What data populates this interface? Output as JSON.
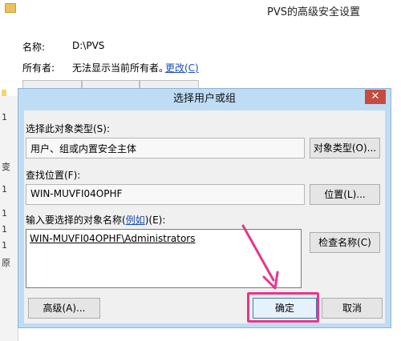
{
  "background_window": {
    "title": "PVS的高级安全设置",
    "name_label": "名称:",
    "name_value": "D:\\PVS",
    "owner_label": "所有者:",
    "owner_value": "无法显示当前所有者。",
    "change_link": "更改(C)",
    "left_strip_chars": [
      "1",
      "变",
      "1",
      "1",
      "1",
      "1",
      "原"
    ]
  },
  "dialog": {
    "title": "选择用户或组",
    "close_glyph": "✕",
    "object_type_label": "选择此对象类型(S):",
    "object_type_value": "用户、组或内置安全主体",
    "object_type_button": "对象类型(O)...",
    "location_label": "查找位置(F):",
    "location_value": "WIN-MUVFI04OPHF",
    "location_button": "位置(L)...",
    "names_label_before": "输入要选择的对象名称(",
    "names_label_link": "例如",
    "names_label_after": ")(E):",
    "names_value": "WIN-MUVFI04OPHF\\Administrators",
    "check_names_button": "检查名称(C)",
    "advanced_button": "高级(A)...",
    "ok_button": "确定",
    "cancel_button": "取消"
  },
  "colors": {
    "highlight": "#e8358a",
    "arrow": "#e8358a",
    "dialog_frame": "#bfdcf5",
    "close": "#c74b3e"
  }
}
